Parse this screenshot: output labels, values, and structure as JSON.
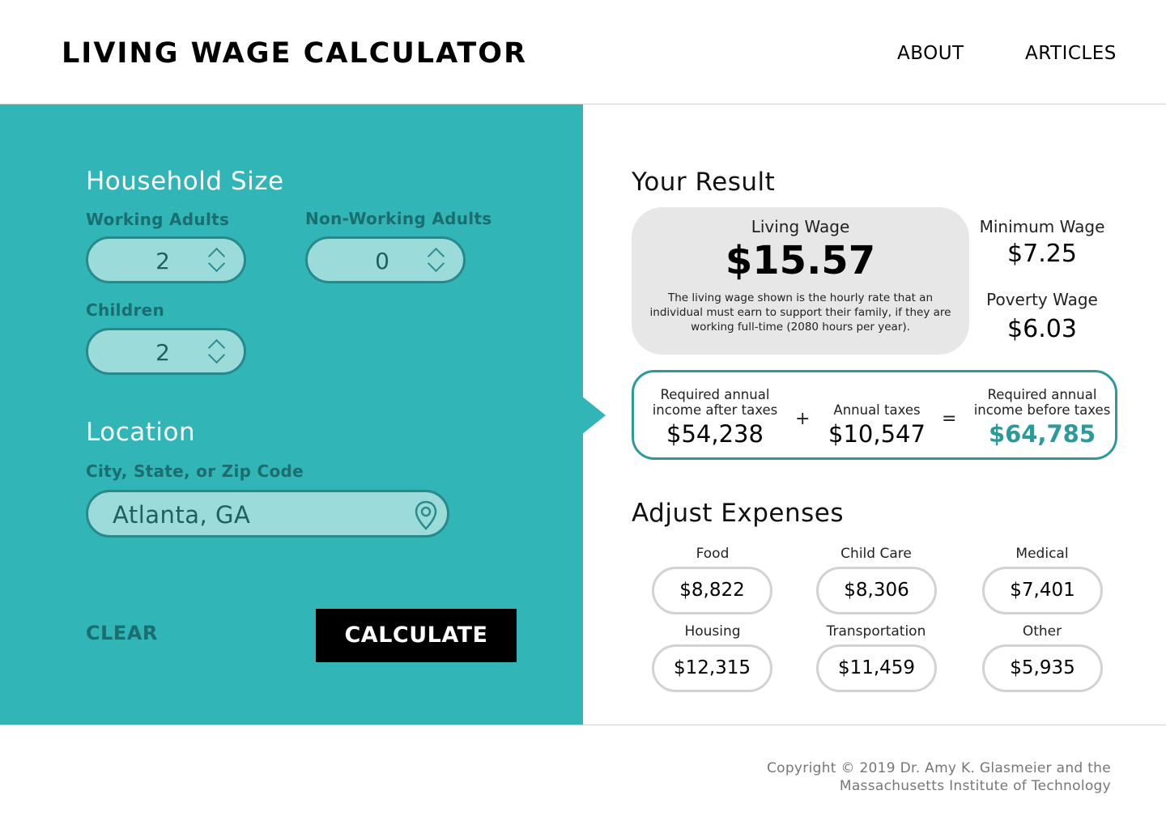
{
  "header": {
    "title": "LIVING WAGE CALCULATOR",
    "nav": [
      "ABOUT",
      "ARTICLES"
    ]
  },
  "form": {
    "household_title": "Household Size",
    "working_adults_label": "Working Adults",
    "working_adults_value": "2",
    "non_working_adults_label": "Non-Working Adults",
    "non_working_adults_value": "0",
    "children_label": "Children",
    "children_value": "2",
    "location_title": "Location",
    "location_label": "City, State, or Zip Code",
    "location_value": "Atlanta, GA",
    "clear_label": "CLEAR",
    "calculate_label": "CALCULATE"
  },
  "result": {
    "title": "Your Result",
    "living_wage_label": "Living Wage",
    "living_wage_value": "$15.57",
    "living_wage_desc": "The living wage shown is the hourly rate that an individual must earn to support their family, if they are working full-time (2080 hours per year).",
    "minimum_wage_label": "Minimum Wage",
    "minimum_wage_value": "$7.25",
    "poverty_wage_label": "Poverty Wage",
    "poverty_wage_value": "$6.03",
    "after_taxes_label": "Required annual income after taxes",
    "after_taxes_value": "$54,238",
    "plus": "+",
    "annual_taxes_label": "Annual taxes",
    "annual_taxes_value": "$10,547",
    "equals": "=",
    "before_taxes_label": "Required annual income before taxes",
    "before_taxes_value": "$64,785"
  },
  "expenses": {
    "title": "Adjust Expenses",
    "items": [
      {
        "label": "Food",
        "value": "$8,822"
      },
      {
        "label": "Child Care",
        "value": "$8,306"
      },
      {
        "label": "Medical",
        "value": "$7,401"
      },
      {
        "label": "Housing",
        "value": "$12,315"
      },
      {
        "label": "Transportation",
        "value": "$11,459"
      },
      {
        "label": "Other",
        "value": "$5,935"
      }
    ]
  },
  "footer": {
    "line1": "Copyright © 2019 Dr. Amy K. Glasmeier and the",
    "line2": "Massachusetts Institute of Technology"
  },
  "colors": {
    "teal": "#31b5b6",
    "teal_dark": "#1b6e70",
    "input_fill": "#9bdcdb",
    "accent": "#2a9a9a"
  },
  "icons": [
    "chevron-up-icon",
    "chevron-down-icon",
    "location-pin-icon"
  ]
}
